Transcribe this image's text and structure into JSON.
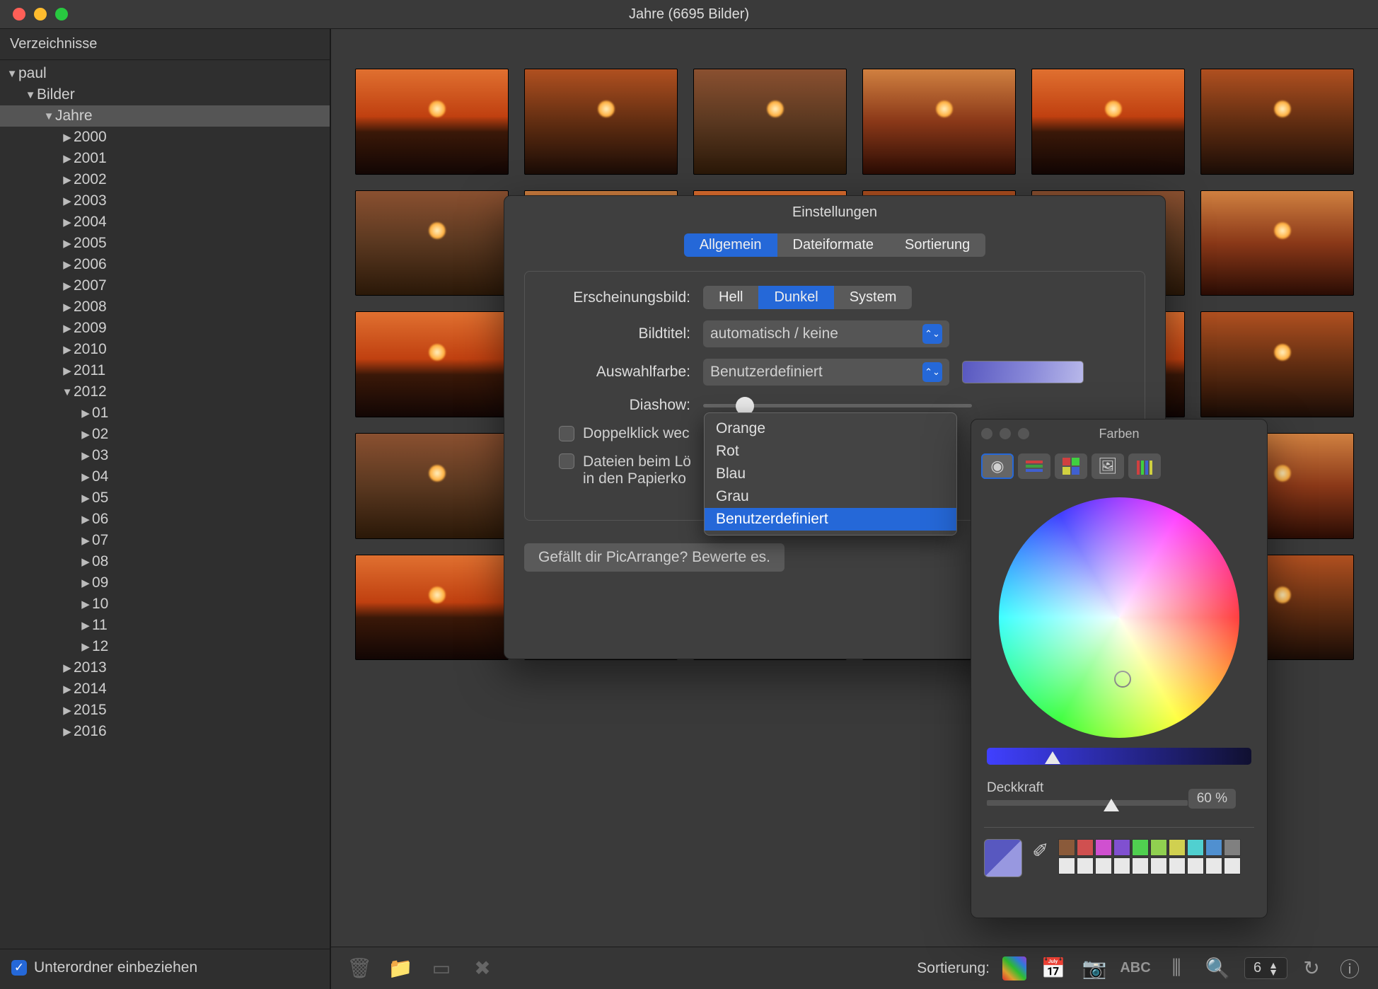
{
  "window": {
    "title": "Jahre (6695 Bilder)"
  },
  "sidebar": {
    "heading": "Verzeichnisse",
    "root": "paul",
    "folder_pictures": "Bilder",
    "folder_years": "Jahre",
    "years": [
      "2000",
      "2001",
      "2002",
      "2003",
      "2004",
      "2005",
      "2006",
      "2007",
      "2008",
      "2009",
      "2010",
      "2011",
      "2012",
      "2013",
      "2014",
      "2015",
      "2016"
    ],
    "months": [
      "01",
      "02",
      "03",
      "04",
      "05",
      "06",
      "07",
      "08",
      "09",
      "10",
      "11",
      "12"
    ],
    "expanded_year": "2012",
    "include_subfolders": "Unterordner einbeziehen"
  },
  "toolbar": {
    "sort_label": "Sortierung:",
    "abc": "ABC",
    "columns_value": "6"
  },
  "settings": {
    "title": "Einstellungen",
    "tabs": {
      "general": "Allgemein",
      "formats": "Dateiformate",
      "sorting": "Sortierung"
    },
    "appearance_label": "Erscheinungsbild:",
    "appearance": {
      "light": "Hell",
      "dark": "Dunkel",
      "system": "System"
    },
    "image_title_label": "Bildtitel:",
    "image_title_value": "automatisch / keine",
    "selection_color_label": "Auswahlfarbe:",
    "selection_color_value": "Benutzerdefiniert",
    "slideshow_label": "Diashow:",
    "doubleclick_label": "Doppelklick wec",
    "delete_label_1": "Dateien beim Lö",
    "delete_label_2": "in den Papierko",
    "rate_button": "Gefällt dir PicArrange? Bewerte es."
  },
  "dropdown": {
    "items": [
      "Orange",
      "Rot",
      "Blau",
      "Grau",
      "Benutzerdefiniert"
    ],
    "selected": "Benutzerdefiniert"
  },
  "colors": {
    "title": "Farben",
    "opacity_label": "Deckkraft",
    "opacity_value": "60 %",
    "palette": [
      "#8a5a3a",
      "#d05050",
      "#d050d0",
      "#8050d0",
      "#50d050",
      "#90d050",
      "#d0d050",
      "#50d0d0",
      "#5090d0",
      "#808080",
      "#e8e8e8",
      "#e8e8e8",
      "#e8e8e8",
      "#e8e8e8",
      "#e8e8e8",
      "#e8e8e8",
      "#e8e8e8",
      "#e8e8e8",
      "#e8e8e8",
      "#e8e8e8"
    ]
  }
}
